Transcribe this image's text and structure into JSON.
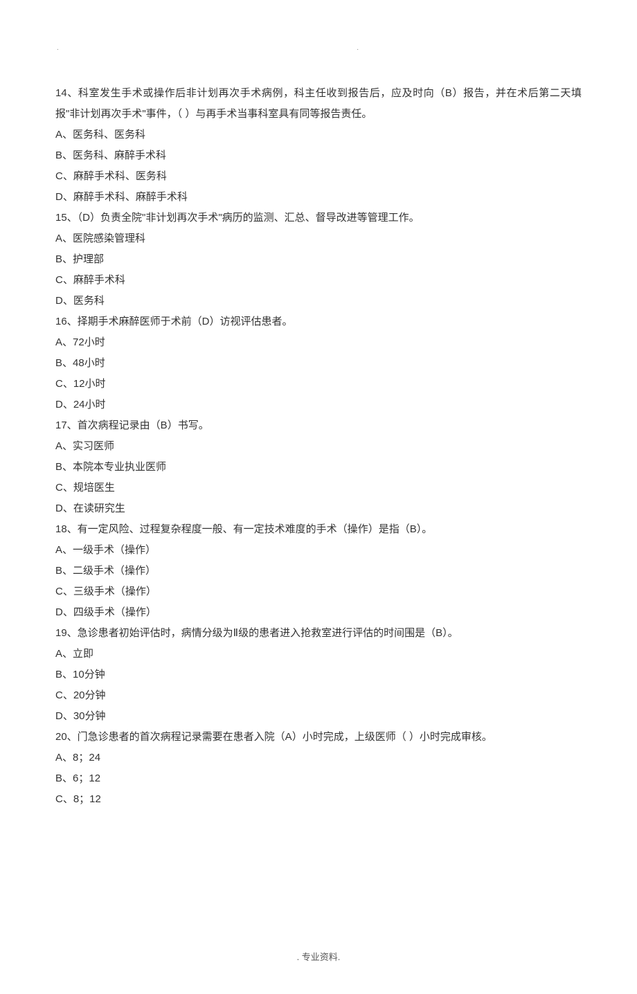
{
  "top_dots": {
    "left": ".",
    "right": "."
  },
  "questions": [
    {
      "text": "14、科室发生手术或操作后非计划再次手术病例，科主任收到报告后，应及时向（B）报告，并在术后第二天填报\"非计划再次手术\"事件，（  ）与再手术当事科室具有同等报告责任。",
      "options": [
        "A、医务科、医务科",
        "B、医务科、麻醉手术科",
        "C、麻醉手术科、医务科",
        "D、麻醉手术科、麻醉手术科"
      ]
    },
    {
      "text": "15、（D）负责全院\"非计划再次手术\"病历的监测、汇总、督导改进等管理工作。",
      "options": [
        "A、医院感染管理科",
        "B、护理部",
        "C、麻醉手术科",
        "D、医务科"
      ]
    },
    {
      "text": "16、择期手术麻醉医师于术前（D）访视评估患者。",
      "options": [
        "A、72小时",
        "B、48小时",
        "C、12小时",
        "D、24小时"
      ]
    },
    {
      "text": "17、首次病程记录由（B）书写。",
      "options": [
        "A、实习医师",
        "B、本院本专业执业医师",
        "C、规培医生",
        "D、在读研究生"
      ]
    },
    {
      "text": "18、有一定风险、过程复杂程度一般、有一定技术难度的手术（操作）是指（B）。",
      "options": [
        "A、一级手术（操作）",
        "B、二级手术（操作）",
        "C、三级手术（操作）",
        "D、四级手术（操作）"
      ]
    },
    {
      "text": "19、急诊患者初始评估时，病情分级为Ⅱ级的患者进入抢救室进行评估的时间围是（B）。",
      "options": [
        "A、立即",
        "B、10分钟",
        "C、20分钟",
        "D、30分钟"
      ]
    },
    {
      "text": "20、门急诊患者的首次病程记录需要在患者入院（A）小时完成，上级医师（   ）小时完成审核。",
      "options": [
        "A、8；24",
        "B、6；12",
        "C、8；12"
      ]
    }
  ],
  "footer": ". 专业资料."
}
